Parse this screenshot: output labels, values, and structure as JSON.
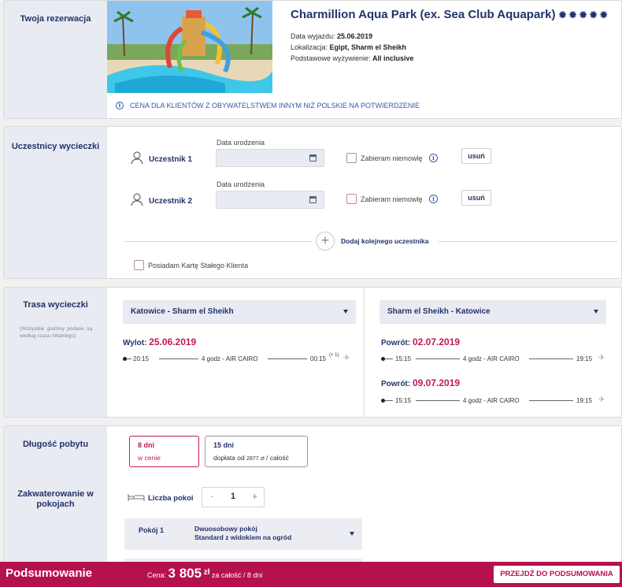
{
  "reservation": {
    "side_title": "Twoja rezerwacja",
    "hotel_name": "Charmillion Aqua Park (ex. Sea Club Aquapark)",
    "stars_count": 5,
    "departure_label": "Data wyjazdu: ",
    "departure_value": "25.06.2019",
    "location_label": "Lokalizacja: ",
    "location_value": "Egipt, Sharm el Sheikh",
    "board_label": "Podstawowe wyżywienie: ",
    "board_value": "All inclusive",
    "notice": "CENA DLA KLIENTÓW Z OBYWATELSTWEM INNYM NIŻ POLSKIE NA POTWIERDZENIE"
  },
  "participants": {
    "side_title": "Uczestnicy wycieczki",
    "list": [
      {
        "label": "Uczestnik 1",
        "dob_label": "Data urodzenia",
        "infant_label": "Zabieram niemowlę",
        "remove_label": "usuń"
      },
      {
        "label": "Uczestnik 2",
        "dob_label": "Data urodzenia",
        "infant_label": "Zabieram niemowlę",
        "remove_label": "usuń"
      }
    ],
    "add_label": "Dodaj kolejnego uczestnika",
    "loyalty_label": "Posiadam Kartę Stałego Klienta"
  },
  "route": {
    "side_title": "Trasa wycieczki",
    "side_note": "(Wszystkie godziny podane są według czasu lokalnego)",
    "outbound": {
      "select": "Katowice - Sharm el Sheikh",
      "label": "Wylot: ",
      "date": "25.06.2019",
      "depart": "20:15",
      "info": "4 godz - AIR CAIRO",
      "arrive": "00:15",
      "arrive_suffix": "(+ 1)"
    },
    "return": {
      "select": "Sharm el Sheikh - Katowice",
      "flights": [
        {
          "label": "Powrót: ",
          "date": "02.07.2019",
          "depart": "15:15",
          "info": "4 godz - AIR CAIRO",
          "arrive": "19:15"
        },
        {
          "label": "Powrót: ",
          "date": "09.07.2019",
          "depart": "15:15",
          "info": "4 godz - AIR CAIRO",
          "arrive": "19:15"
        }
      ]
    }
  },
  "stay": {
    "side_title": "Długość pobytu",
    "options": [
      {
        "title": "8 dni",
        "subtitle": "w cenie",
        "selected": true
      },
      {
        "title": "15 dni",
        "subtitle_prefix": "dopłata od ",
        "subtitle_amount": "2877 zł",
        "subtitle_suffix": " / całość",
        "selected": false
      }
    ]
  },
  "rooms": {
    "side_title": "Zakwaterowanie w pokojach",
    "count_label": "Liczba pokoi",
    "minus": "-",
    "count": "1",
    "plus": "+",
    "room_label": "Pokój 1",
    "room_type_line1": "Dwuosobowy pokój",
    "room_type_line2": "Standard z widokiem na ogród"
  },
  "summary": {
    "title": "Podsumowanie",
    "price_label": "Cena: ",
    "price_amount": "3 805",
    "currency": "zł",
    "price_suffix": " za całość / 8 dni",
    "button_label": "PRZEJDŹ DO PODSUMOWANIA"
  },
  "colors": {
    "accent": "#b5114f",
    "navy": "#23326b",
    "side_bg": "#e9ebf2",
    "date_red": "#c2185b"
  }
}
